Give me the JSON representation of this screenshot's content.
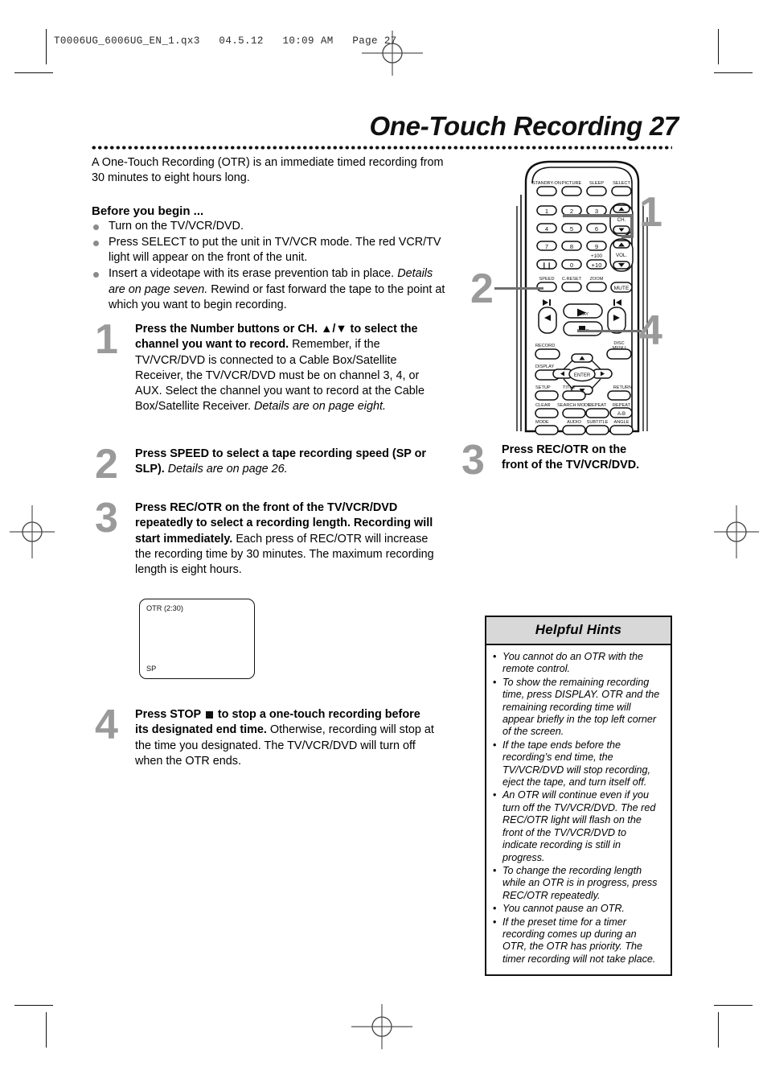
{
  "print_header": "T0006UG_6006UG_EN_1.qx3   04.5.12   10:09 AM   Page 27",
  "title": "One-Touch Recording  27",
  "intro": "A One-Touch Recording (OTR) is an immediate timed recording from 30 minutes to eight hours long.",
  "before": {
    "heading": "Before you begin ...",
    "items": [
      "Turn on the TV/VCR/DVD.",
      "Press SELECT to put the unit in TV/VCR mode. The red VCR/TV light will appear on the front of the unit.",
      "Insert a videotape with its erase prevention tab in place. Details are on page seven. Rewind or fast forward the tape to the point at which you want to begin recording."
    ],
    "item3_italic_lead": "Details are on page seven.",
    "item3_rest": " Rewind or fast forward the tape to the point at which you want to begin recording."
  },
  "steps": [
    {
      "number": "1",
      "lead": "Press the Number buttons or CH. ▲/▼ to select the channel you want to record.",
      "body": "Remember, if the TV/VCR/DVD is connected to a Cable Box/Satellite Receiver, the TV/VCR/DVD must be on channel 3, 4, or AUX.",
      "body2": "Select the channel you want to record at the Cable Box/Satellite Receiver. ",
      "body2_italic": "Details are on page eight."
    },
    {
      "number": "2",
      "lead": "Press SPEED to select a tape recording speed (SP or SLP). ",
      "lead_italic": "Details are on page 26."
    },
    {
      "number": "3",
      "lead": "Press REC/OTR on the front of the TV/VCR/DVD repeatedly to select a recording length. Recording will start immediately.",
      "body": "Each press of REC/OTR will increase the recording time by 30 minutes. The maximum recording length is eight hours."
    },
    {
      "number": "4",
      "lead_a": "Press STOP ",
      "lead_b": " to stop a one-touch recording before its designated end time.",
      "body": " Otherwise, recording will stop at the time you designated. The TV/VCR/DVD will turn off when the OTR ends."
    }
  ],
  "tv_screen": {
    "otr_label": "OTR (2:30)",
    "speed_label": "SP"
  },
  "step3_right": {
    "number": "3",
    "text": "Press REC/OTR on the front of the TV/VCR/DVD."
  },
  "callouts": {
    "one": "1",
    "two": "2",
    "four": "4"
  },
  "remote": {
    "top_row": [
      "STANDBY-ON",
      "PICTURE",
      "SLEEP",
      "SELECT"
    ],
    "numbers": [
      "1",
      "2",
      "3",
      "4",
      "5",
      "6",
      "7",
      "8",
      "9",
      "Ⅱ",
      "0",
      "+10"
    ],
    "plus100": "+100",
    "ch_label": "CH.",
    "vol_label": "VOL.",
    "mute": "MUTE",
    "fn_row": [
      "SPEED",
      "C.RESET",
      "ZOOM"
    ],
    "play": "PLAY",
    "stop": "STOP",
    "record": "RECORD",
    "disc_menu_line1": "DISC",
    "disc_menu_line2": "MENU",
    "display": "DISPLAY",
    "enter": "ENTER",
    "setup": "SETUP",
    "title_btn": "TITLE",
    "return_btn": "RETURN",
    "row_clear": [
      "CLEAR",
      "SEARCH MODE",
      "REPEAT",
      "REPEAT"
    ],
    "repeat_ab": "A-B",
    "row_mode": [
      "MODE",
      "AUDIO",
      "SUBTITLE",
      "ANGLE"
    ]
  },
  "hints": {
    "title": "Helpful Hints",
    "items": [
      "You cannot do an OTR with the remote control.",
      "To show the remaining recording time, press DISPLAY. OTR and the remaining recording time will appear briefly in the top left corner of the screen.",
      "If the tape ends before the recording’s end time, the TV/VCR/DVD will stop recording, eject the tape, and turn itself off.",
      "An OTR will continue even if you turn off the TV/VCR/DVD. The red REC/OTR light will flash on the front of the TV/VCR/DVD to indicate recording is still in progress.",
      "To change the recording length while an OTR is in progress, press REC/OTR repeatedly.",
      "You cannot pause an OTR.",
      "If the preset time for a timer recording comes up during an OTR, the OTR has priority. The timer recording will not take place."
    ]
  },
  "colors": {
    "step_number": "#9a9a9a",
    "hints_header_bg": "#d8d8d8",
    "bullet": "#8b8b8b",
    "ink": "#111111"
  }
}
